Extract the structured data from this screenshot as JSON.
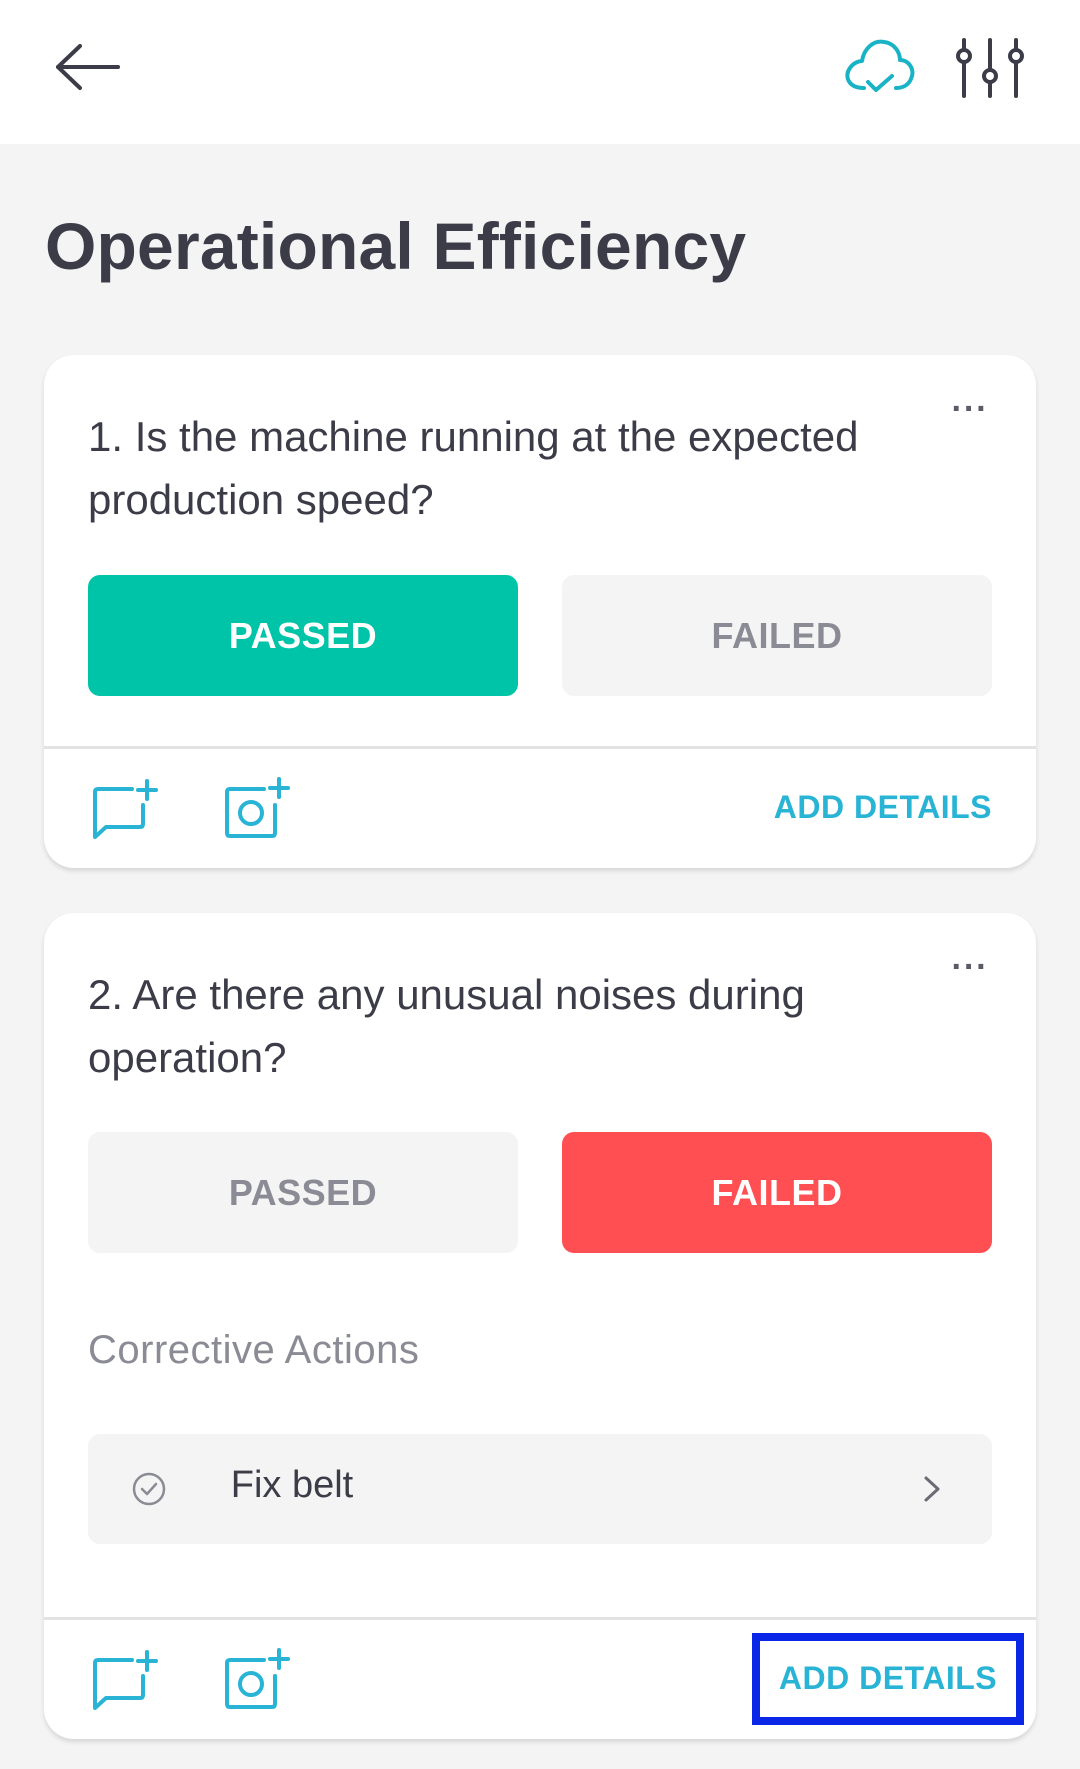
{
  "header": {
    "back_icon": "arrow-left-icon",
    "sync_icon": "cloud-check-icon",
    "filter_icon": "sliders-icon"
  },
  "page": {
    "title": "Operational Efficiency"
  },
  "questions": [
    {
      "text": "1. Is the machine running at the expected production speed?",
      "more": "···",
      "passed_label": "PASSED",
      "failed_label": "FAILED",
      "selected": "PASSED",
      "add_details_label": "ADD DETAILS"
    },
    {
      "text": "2. Are there any unusual noises during operation?",
      "more": "···",
      "passed_label": "PASSED",
      "failed_label": "FAILED",
      "selected": "FAILED",
      "corrective_actions_label": "Corrective Actions",
      "actions": [
        {
          "text": "Fix belt"
        }
      ],
      "add_details_label": "ADD DETAILS"
    }
  ],
  "colors": {
    "passed": "#00c4a7",
    "failed": "#ff4f52",
    "accent": "#29b4d6",
    "highlight": "#0a26e6"
  }
}
